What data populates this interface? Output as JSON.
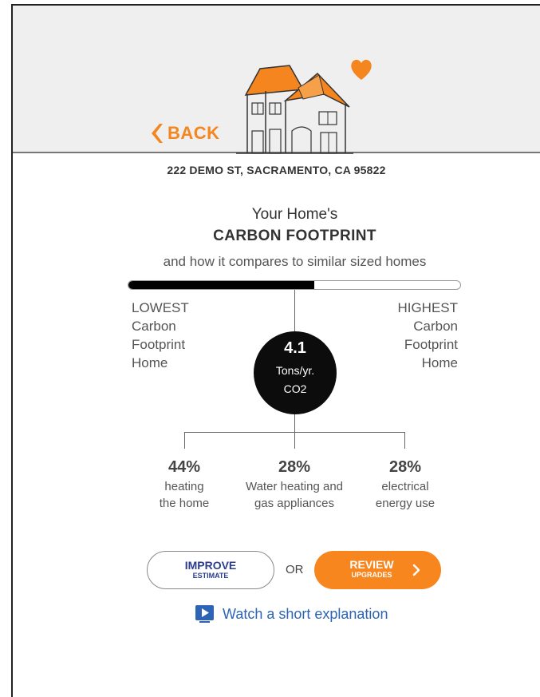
{
  "header": {
    "back_label": "BACK",
    "brand_color": "#f5851f"
  },
  "address": "222 DEMO ST, SACRAMENTO, CA 95822",
  "title": {
    "line1": "Your Home's",
    "line2": "CARBON FOOTPRINT",
    "subtitle": "and how it compares to similar sized homes"
  },
  "comparison": {
    "bar_fill_fraction": 0.56,
    "lowest_label": [
      "LOWEST",
      "Carbon",
      "Footprint",
      "Home"
    ],
    "highest_label": [
      "HIGHEST",
      "Carbon",
      "Footprint",
      "Home"
    ]
  },
  "footprint": {
    "value": "4.1",
    "unit": "Tons/yr.",
    "gas": "CO2"
  },
  "breakdown": [
    {
      "percent": "44%",
      "desc1": "heating",
      "desc2": "the home"
    },
    {
      "percent": "28%",
      "desc1": "Water heating and",
      "desc2": "gas appliances"
    },
    {
      "percent": "28%",
      "desc1": "electrical",
      "desc2": "energy use"
    }
  ],
  "actions": {
    "improve_main": "IMPROVE",
    "improve_sub": "ESTIMATE",
    "or_label": "OR",
    "review_main": "REVIEW",
    "review_sub": "UPGRADES",
    "watch_label": "Watch a short explanation",
    "accent_color": "#f7861e",
    "link_color": "#2d64b5"
  },
  "icons": {
    "back": "chevron-left-icon",
    "house": "house-icon",
    "heart": "heart-icon",
    "arrow": "chevron-right-icon",
    "video": "video-play-icon"
  }
}
